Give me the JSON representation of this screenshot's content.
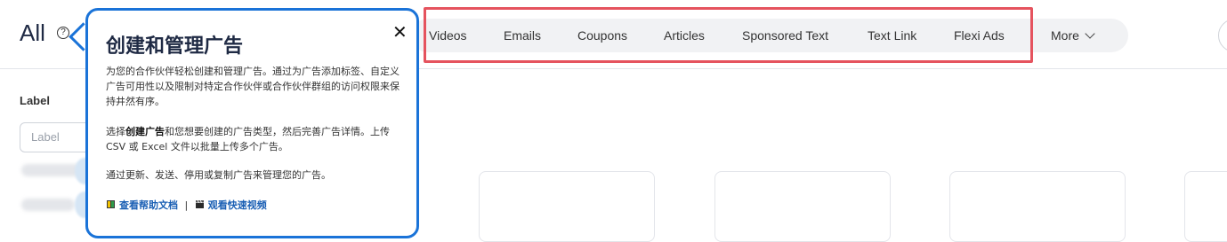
{
  "page": {
    "title": "All",
    "help_icon": "?"
  },
  "filters": {
    "label_heading": "Label",
    "label_placeholder": "Label"
  },
  "tabs": [
    {
      "label": "Videos"
    },
    {
      "label": "Emails"
    },
    {
      "label": "Coupons"
    },
    {
      "label": "Articles"
    },
    {
      "label": "Sponsored Text"
    },
    {
      "label": "Text Link"
    },
    {
      "label": "Flexi Ads"
    }
  ],
  "more_tab": {
    "label": "More"
  },
  "popover": {
    "title": "创建和管理广告",
    "close": "✕",
    "para1": "为您的合作伙伴轻松创建和管理广告。通过为广告添加标签、自定义广告可用性以及限制对特定合作伙伴或合作伙伴群组的访问权限来保持井然有序。",
    "para2_prefix": "选择",
    "para2_bold": "创建广告",
    "para2_suffix": "和您想要创建的广告类型，然后完善广告详情。上传 CSV 或 Excel 文件以批量上传多个广告。",
    "para3": "通过更新、发送、停用或复制广告来管理您的广告。",
    "link_docs": "查看帮助文档",
    "separator": "|",
    "link_video": "观看快速视频"
  },
  "colors": {
    "accent_blue": "#1a73d8",
    "highlight_red": "#e5535e",
    "tab_bg": "#f1f2f4"
  }
}
